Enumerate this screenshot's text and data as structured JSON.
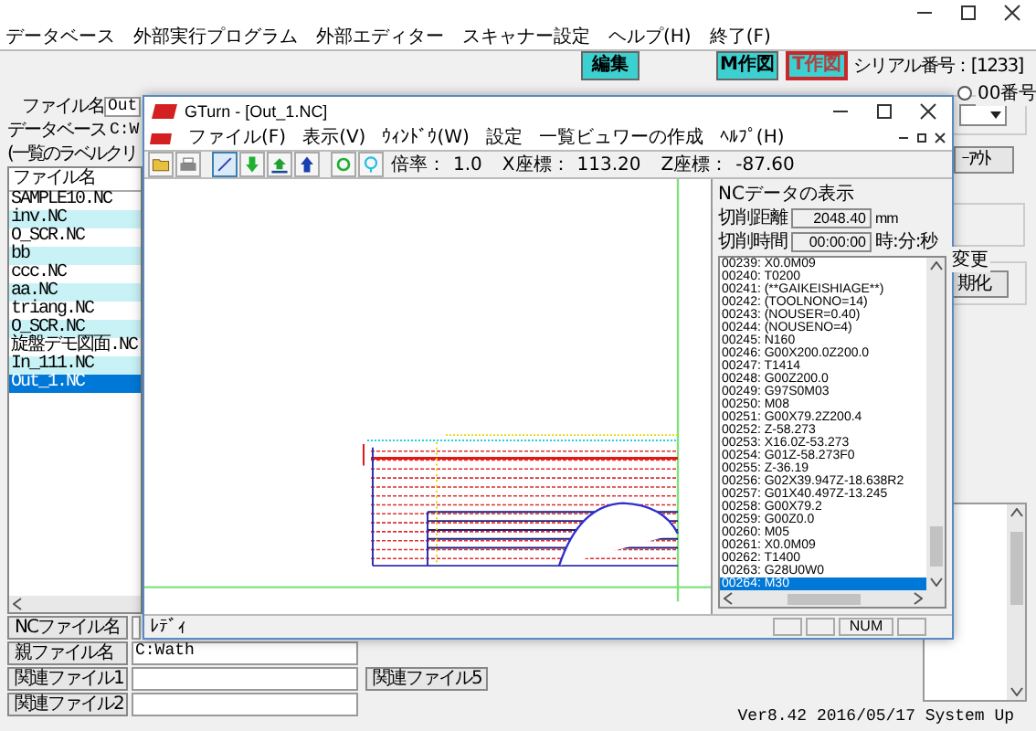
{
  "main_menu": [
    "データベース",
    "外部実行プログラム",
    "外部エディター",
    "スキャナー設定",
    "ヘルプ(H)",
    "終了(F)"
  ],
  "top_buttons": [
    {
      "label": "編集",
      "selected": false
    },
    {
      "label": "M作図",
      "selected": false
    },
    {
      "label": "T作図",
      "selected": true
    }
  ],
  "serial": "シリアル番号：[1233]",
  "file_name": {
    "label": "ファイル名",
    "value": "Out"
  },
  "database": {
    "label": "データベース",
    "value": "C:W"
  },
  "list_hint": "(一覧のラベルクリ",
  "file_list": {
    "header": "ファイル名",
    "items": [
      {
        "name": "SAMPLE10.NC",
        "selected": false
      },
      {
        "name": "inv.NC",
        "selected": false
      },
      {
        "name": "O_SCR.NC",
        "selected": false
      },
      {
        "name": "bb",
        "selected": false
      },
      {
        "name": "ccc.NC",
        "selected": false
      },
      {
        "name": "aa.NC",
        "selected": false
      },
      {
        "name": "triang.NC",
        "selected": false
      },
      {
        "name": "O_SCR.NC",
        "selected": false
      },
      {
        "name": "旋盤デモ図面.NC",
        "selected": false
      },
      {
        "name": "In_111.NC",
        "selected": false
      },
      {
        "name": "Out_1.NC",
        "selected": true
      }
    ]
  },
  "file_fields": [
    {
      "label": "NCファイル名"
    },
    {
      "label": "親ファイル名",
      "value": "C:Wath"
    },
    {
      "label": "関連ファイル1"
    },
    {
      "label": "関連ファイル2"
    }
  ],
  "related_file5": "関連ファイル5",
  "number_group": {
    "label": "00番号",
    "checked": false
  },
  "layout_button": "ｰｱｳﾄ",
  "change_group": {
    "label": "変更",
    "button": "期化"
  },
  "version": "Ver8.42 2016/05/17 System Up",
  "child_window": {
    "title": "GTurn - [Out_1.NC]",
    "menu": [
      "ファイル(F)",
      "表示(V)",
      "ｳｨﾝﾄﾞｳ(W)",
      "設定",
      "一覧ビュワーの作成",
      "ﾍﾙﾌﾟ(H)"
    ],
    "line_tool": {
      "pressed": true
    },
    "scale": {
      "label": "倍率：",
      "value": "1.0"
    },
    "x_coord": {
      "label": "X座標：",
      "value": "113.20"
    },
    "z_coord": {
      "label": "Z座標：",
      "value": "-87.60"
    },
    "nc_panel": {
      "title": "NCデータの表示",
      "distance": {
        "label": "切削距離",
        "value": "2048.40",
        "unit": "mm"
      },
      "time": {
        "label": "切削時間",
        "value": "00:00:00",
        "unit": "時:分:秒"
      },
      "lines": [
        {
          "text": "00239: X0.0M09",
          "selected": false
        },
        {
          "text": "00240: T0200",
          "selected": false
        },
        {
          "text": "00241: (**GAIKEISHIAGE**)",
          "selected": false
        },
        {
          "text": "00242: (TOOLNONO=14)",
          "selected": false
        },
        {
          "text": "00243: (NOUSER=0.40)",
          "selected": false
        },
        {
          "text": "00244: (NOUSENO=4)",
          "selected": false
        },
        {
          "text": "00245: N160",
          "selected": false
        },
        {
          "text": "00246: G00X200.0Z200.0",
          "selected": false
        },
        {
          "text": "00247: T1414",
          "selected": false
        },
        {
          "text": "00248: G00Z200.0",
          "selected": false
        },
        {
          "text": "00249: G97S0M03",
          "selected": false
        },
        {
          "text": "00250: M08",
          "selected": false
        },
        {
          "text": "00251: G00X79.2Z200.4",
          "selected": false
        },
        {
          "text": "00252: Z-58.273",
          "selected": false
        },
        {
          "text": "00253: X16.0Z-53.273",
          "selected": false
        },
        {
          "text": "00254: G01Z-58.273F0",
          "selected": false
        },
        {
          "text": "00255: Z-36.19",
          "selected": false
        },
        {
          "text": "00256: G02X39.947Z-18.638R2",
          "selected": false
        },
        {
          "text": "00257: G01X40.497Z-13.245",
          "selected": false
        },
        {
          "text": "00258: G00X79.2",
          "selected": false
        },
        {
          "text": "00259: G00Z0.0",
          "selected": false
        },
        {
          "text": "00260: M05",
          "selected": false
        },
        {
          "text": "00261: X0.0M09",
          "selected": false
        },
        {
          "text": "00262: T1400",
          "selected": false
        },
        {
          "text": "00263: G28U0W0",
          "selected": false
        },
        {
          "text": "00264: M30",
          "selected": true
        }
      ]
    },
    "status": {
      "message": "ﾚﾃﾞｨ",
      "indicator": "NUM"
    }
  }
}
